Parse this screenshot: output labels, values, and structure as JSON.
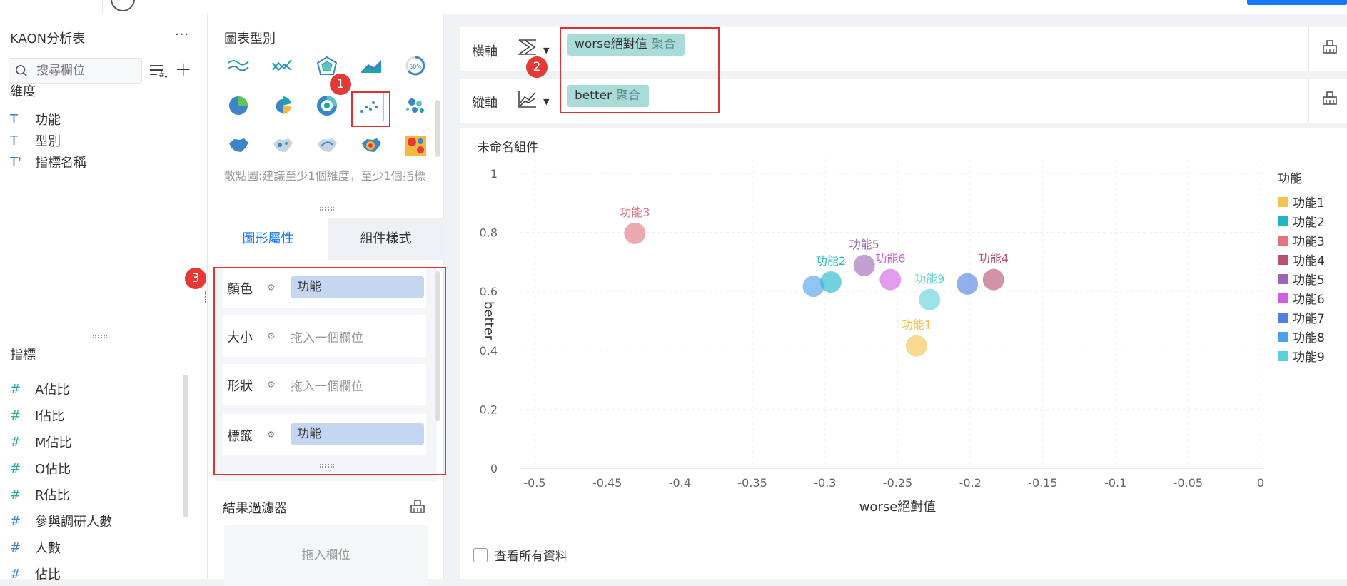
{
  "left_panel": {
    "title": "KAON分析表",
    "more": "···",
    "search_placeholder": "搜尋欄位",
    "dimensions_title": "維度",
    "dimensions": [
      "功能",
      "型別",
      "指標名稱"
    ],
    "metrics_title": "指標",
    "metrics": [
      "A佔比",
      "I佔比",
      "M佔比",
      "O佔比",
      "R佔比",
      "參與調研人數",
      "人數",
      "佔比"
    ]
  },
  "middle_panel": {
    "chart_types_title": "圖表型別",
    "hint": "散點圖:建議至少1個維度，至少1個指標",
    "tabs": [
      "圖形屬性",
      "組件樣式"
    ],
    "props": [
      {
        "label": "顏色",
        "value": "功能"
      },
      {
        "label": "大小",
        "placeholder": "拖入一個欄位"
      },
      {
        "label": "形狀",
        "placeholder": "拖入一個欄位"
      },
      {
        "label": "標籤",
        "value": "功能"
      }
    ],
    "filter_title": "結果過濾器",
    "filter_drop": "拖入欄位"
  },
  "axes": {
    "x_label": "橫軸",
    "x_field": "worse絕對值",
    "x_agg": "聚合",
    "y_label": "縱軸",
    "y_field": "better",
    "y_agg": "聚合"
  },
  "chart_title": "未命名組件",
  "show_all_label": "查看所有資料",
  "badges": [
    "1",
    "2",
    "3"
  ],
  "legend_title": "功能",
  "chart_data": {
    "type": "scatter",
    "xlabel": "worse絕對值",
    "ylabel": "better",
    "xlim": [
      -0.5,
      0
    ],
    "ylim": [
      0,
      1
    ],
    "xticks": [
      "-0.5",
      "-0.45",
      "-0.4",
      "-0.35",
      "-0.3",
      "-0.25",
      "-0.2",
      "-0.15",
      "-0.1",
      "-0.05",
      "0"
    ],
    "yticks": [
      "0",
      "0.2",
      "0.4",
      "0.6",
      "0.8",
      "1"
    ],
    "legend_title": "功能",
    "series": [
      {
        "name": "功能1",
        "color": "#f5c14f",
        "x": -0.237,
        "y": 0.415,
        "label": "功能1"
      },
      {
        "name": "功能2",
        "color": "#1fb6c8",
        "x": -0.296,
        "y": 0.632,
        "label": "功能2"
      },
      {
        "name": "功能3",
        "color": "#e0757f",
        "x": -0.431,
        "y": 0.797,
        "label": "功能3"
      },
      {
        "name": "功能4",
        "color": "#b5506e",
        "x": -0.184,
        "y": 0.64,
        "label": "功能4"
      },
      {
        "name": "功能5",
        "color": "#9b66b6",
        "x": -0.273,
        "y": 0.688,
        "label": "功能5"
      },
      {
        "name": "功能6",
        "color": "#cf5fe0",
        "x": -0.255,
        "y": 0.64,
        "label": "功能6"
      },
      {
        "name": "功能7",
        "color": "#4f7fe0",
        "x": -0.202,
        "y": 0.625,
        "label": ""
      },
      {
        "name": "功能8",
        "color": "#4ca0ea",
        "x": -0.308,
        "y": 0.617,
        "label": ""
      },
      {
        "name": "功能9",
        "color": "#5fd0dc",
        "x": -0.228,
        "y": 0.572,
        "label": "功能9"
      }
    ]
  }
}
